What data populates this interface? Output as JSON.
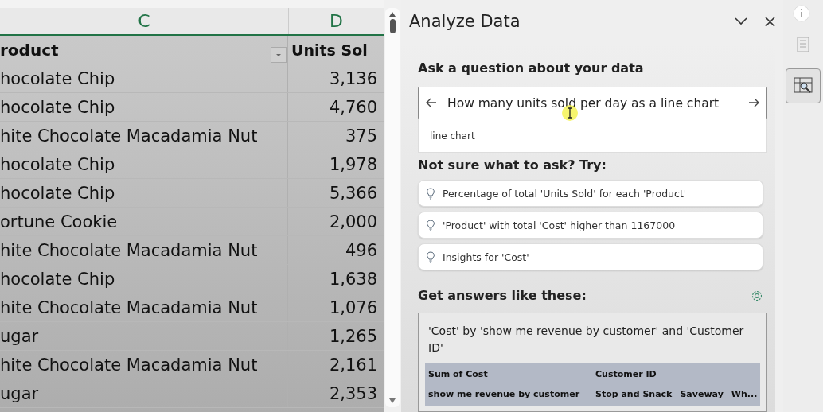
{
  "sheet": {
    "column_headers": [
      "C",
      "D"
    ],
    "header": {
      "product": "roduct",
      "units": "Units Sol"
    },
    "rows": [
      {
        "product": "hocolate Chip",
        "units": "3,136"
      },
      {
        "product": "hocolate Chip",
        "units": "4,760"
      },
      {
        "product": "hite Chocolate Macadamia Nut",
        "units": "375"
      },
      {
        "product": "hocolate Chip",
        "units": "1,978"
      },
      {
        "product": "hocolate Chip",
        "units": "5,366"
      },
      {
        "product": "ortune Cookie",
        "units": "2,000"
      },
      {
        "product": "hite Chocolate Macadamia Nut",
        "units": "496"
      },
      {
        "product": "hocolate Chip",
        "units": "1,638"
      },
      {
        "product": "hite Chocolate Macadamia Nut",
        "units": "1,076"
      },
      {
        "product": "ugar",
        "units": "1,265"
      },
      {
        "product": "hite Chocolate Macadamia Nut",
        "units": "2,161"
      },
      {
        "product": "ugar",
        "units": "2,353"
      }
    ]
  },
  "panel": {
    "title": "Analyze Data",
    "ask_heading": "Ask a question about your data",
    "question": {
      "value": "How many units sold per day as a line chart"
    },
    "autocomplete": [
      "line chart"
    ],
    "suggestions_heading": "Not sure what to ask? Try:",
    "suggestions": [
      "Percentage of total 'Units Sold' for each 'Product'",
      "'Product' with total 'Cost' higher than 1167000",
      "Insights for 'Cost'"
    ],
    "answers_heading": "Get answers like these:",
    "answer": {
      "title": "'Cost' by 'show me revenue by customer' and 'Customer ID'",
      "table_rows": [
        [
          "Sum of Cost",
          "Customer ID"
        ],
        [
          "show me revenue by customer",
          "Stop and Snack",
          "Saveway",
          "Wh..."
        ]
      ]
    }
  },
  "rail": [
    {
      "kind": "doc",
      "selected": false
    },
    {
      "kind": "analyze",
      "selected": true
    }
  ]
}
